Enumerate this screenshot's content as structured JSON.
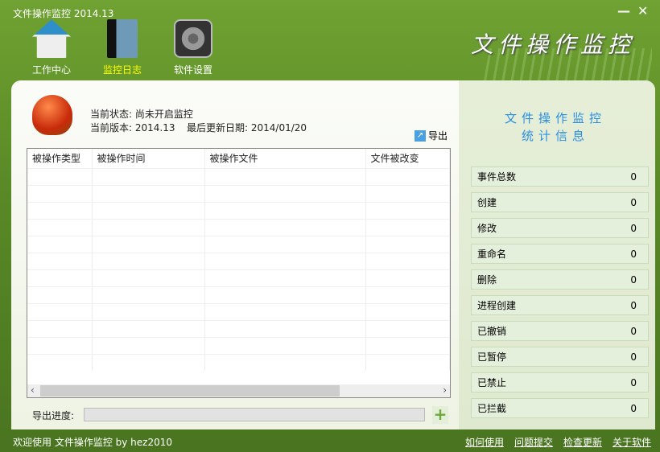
{
  "window": {
    "title": "文件操作监控 2014.13",
    "minimize": "—",
    "close": "✕"
  },
  "nav": [
    {
      "label": "工作中心",
      "icon": "home-icon"
    },
    {
      "label": "监控日志",
      "icon": "book-icon",
      "active": true
    },
    {
      "label": "软件设置",
      "icon": "gear-icon"
    }
  ],
  "brand": "文件操作监控",
  "info": {
    "status_label": "当前状态:",
    "status": "尚未开启监控",
    "version_label": "当前版本:",
    "version": "2014.13",
    "update_label": "最后更新日期:",
    "update": "2014/01/20"
  },
  "export_label": "导出",
  "table": {
    "headers": [
      "被操作类型",
      "被操作时间",
      "被操作文件",
      "文件被改变"
    ],
    "rows": 12
  },
  "progress": {
    "label": "导出进度:",
    "value": 0
  },
  "stats_title": [
    "文件操作监控",
    "统计信息"
  ],
  "stats": [
    {
      "label": "事件总数",
      "value": "0"
    },
    {
      "label": "创建",
      "value": "0"
    },
    {
      "label": "修改",
      "value": "0"
    },
    {
      "label": "重命名",
      "value": "0"
    },
    {
      "label": "删除",
      "value": "0"
    },
    {
      "label": "进程创建",
      "value": "0"
    },
    {
      "label": "已撤销",
      "value": "0"
    },
    {
      "label": "已暂停",
      "value": "0"
    },
    {
      "label": "已禁止",
      "value": "0"
    },
    {
      "label": "已拦截",
      "value": "0"
    }
  ],
  "footer": {
    "welcome": "欢迎使用 文件操作监控 by hez2010",
    "links": [
      "如何使用",
      "问题提交",
      "检查更新",
      "关于软件"
    ]
  },
  "colors": {
    "active_nav": "#ffff00",
    "stat_title": "#2a8fe0"
  }
}
